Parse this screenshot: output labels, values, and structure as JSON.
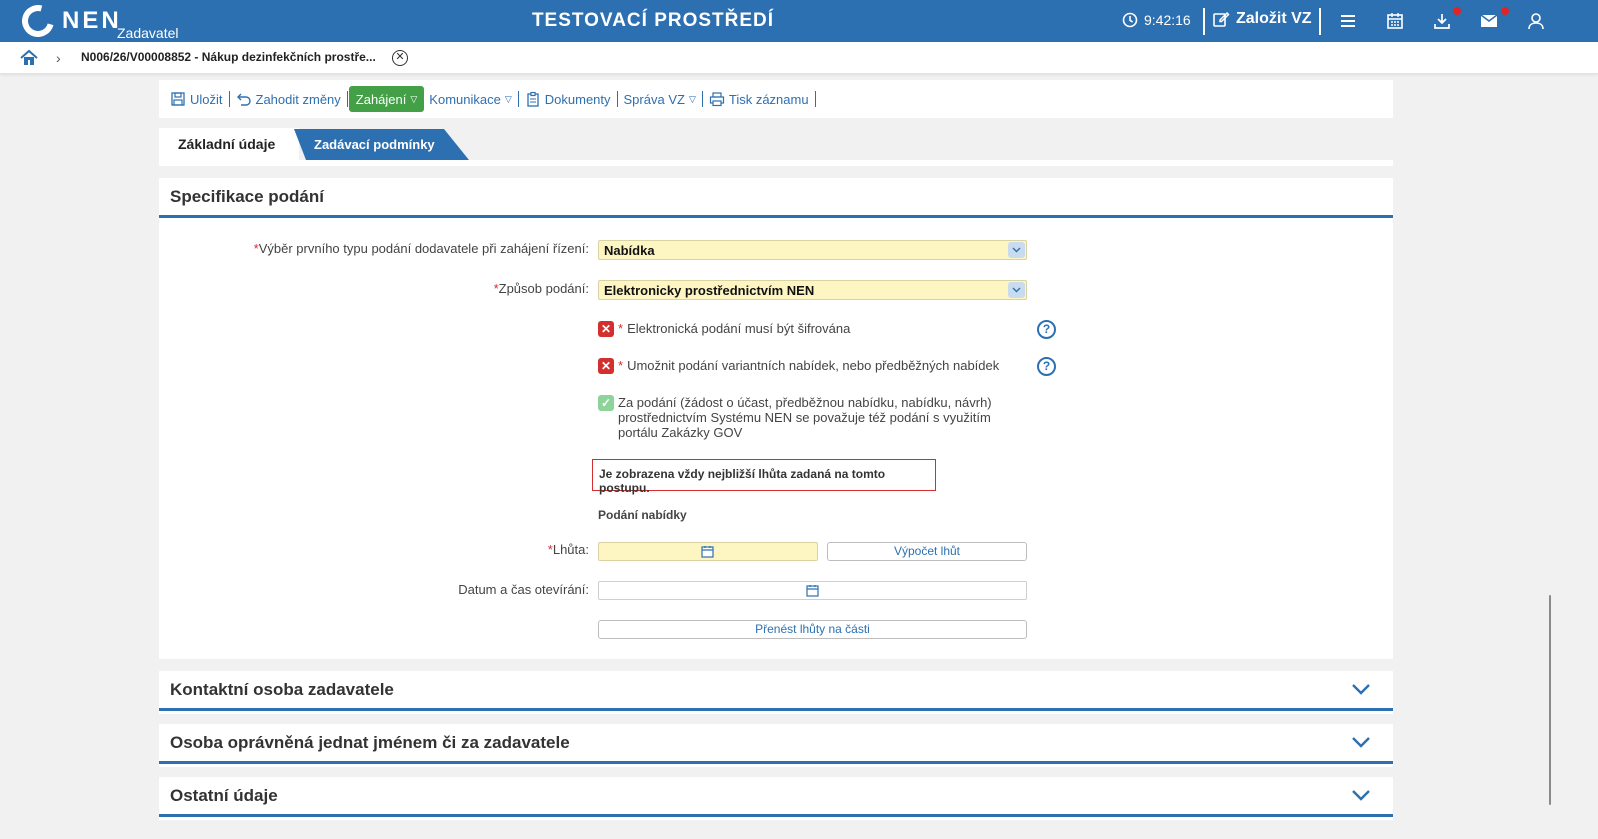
{
  "header": {
    "logo_text": "NEN",
    "logo_sub": "Zadavatel",
    "env_title": "TESTOVACÍ PROSTŘEDÍ",
    "time": "9:42:16",
    "create_label": "Založit VZ",
    "accent": "#2d70b1"
  },
  "breadcrumb": {
    "title": "N006/26/V00008852 - Nákup dezinfekčních prostře..."
  },
  "toolbar": {
    "save": "Uložit",
    "discard": "Zahodit změny",
    "start": "Zahájení",
    "communication": "Komunikace",
    "documents": "Dokumenty",
    "manage": "Správa VZ",
    "print": "Tisk záznamu"
  },
  "tabs": {
    "basic": "Základní údaje",
    "conditions": "Zadávací podmínky"
  },
  "spec": {
    "title": "Specifikace podání",
    "first_type_label": "Výběr prvního typu podání dodavatele při zahájení řízení:",
    "first_type_value": "Nabídka",
    "method_label": "Způsob podání:",
    "method_value": "Elektronicky prostřednictvím NEN",
    "encrypted_label": "Elektronická podání musí být šifrována",
    "variants_label": "Umožnit podání variantních nabídek, nebo předběžných nabídek",
    "gov_label": "Za podání (žádost o účast, předběžnou nabídku, nabídku, návrh) prostřednictvím Systému NEN se považuje též podání s využitím portálu Zakázky GOV",
    "notice": "Je zobrazena vždy nejbližší lhůta zadaná na tomto postupu.",
    "subhead": "Podání nabídky",
    "deadline_label": "Lhůta:",
    "calc_button": "Výpočet lhůt",
    "opening_label": "Datum a čas otevírání:",
    "transfer_button": "Přenést lhůty na části"
  },
  "sections": {
    "contact": "Kontaktní osoba zadavatele",
    "authorized": "Osoba oprávněná jednat jménem či za zadavatele",
    "other": "Ostatní údaje"
  }
}
